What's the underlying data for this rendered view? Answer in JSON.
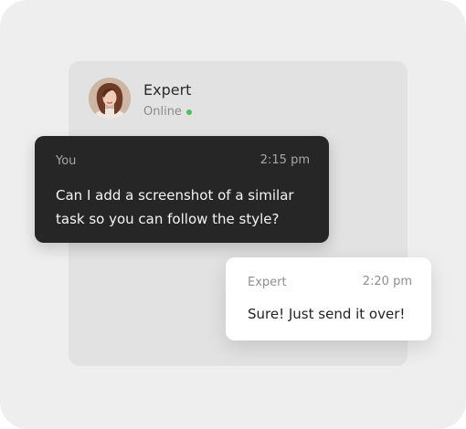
{
  "contact": {
    "name": "Expert",
    "status": "Online",
    "status_color": "#4cc25a",
    "avatar_icon": "user-avatar-photo"
  },
  "messages": [
    {
      "sender": "You",
      "time": "2:15 pm",
      "text": "Can I add a screenshot of a similar task so you can follow the style?",
      "style": "dark"
    },
    {
      "sender": "Expert",
      "time": "2:20 pm",
      "text": "Sure! Just send it over!",
      "style": "light"
    }
  ],
  "colors": {
    "background": "#eeeeee",
    "panel": "#e2e2e2",
    "dark_bubble": "#262626",
    "light_bubble": "#ffffff"
  }
}
